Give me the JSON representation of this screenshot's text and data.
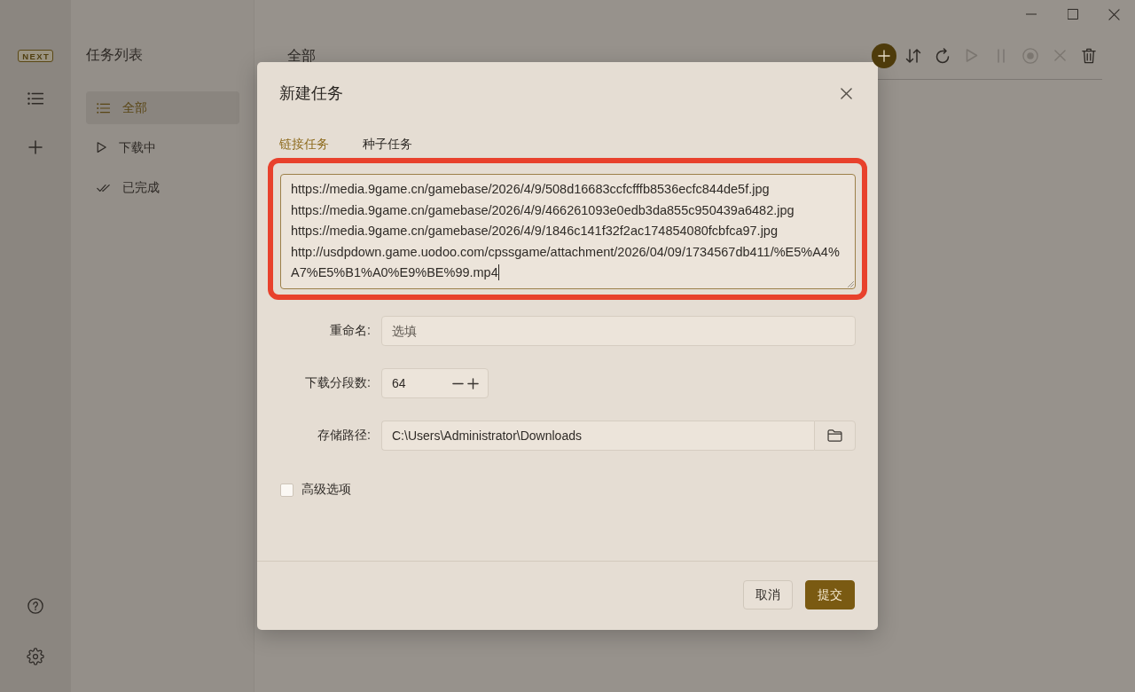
{
  "app_rail": {
    "logo": "NEXT"
  },
  "task_list": {
    "title": "任务列表",
    "items": [
      {
        "label": "全部",
        "kind": "all",
        "selected": true
      },
      {
        "label": "下载中",
        "kind": "downloading",
        "selected": false
      },
      {
        "label": "已完成",
        "kind": "completed",
        "selected": false
      }
    ]
  },
  "main": {
    "title": "全部",
    "toolbar": [
      {
        "kind": "add",
        "disabled": false
      },
      {
        "kind": "sort",
        "disabled": false
      },
      {
        "kind": "refresh",
        "disabled": false
      },
      {
        "kind": "start",
        "disabled": true
      },
      {
        "kind": "pause",
        "disabled": true
      },
      {
        "kind": "stop",
        "disabled": true
      },
      {
        "kind": "cancel",
        "disabled": true
      },
      {
        "kind": "delete",
        "disabled": false
      }
    ]
  },
  "dialog": {
    "title": "新建任务",
    "tabs": [
      {
        "label": "链接任务",
        "selected": true
      },
      {
        "label": "种子任务",
        "selected": false
      }
    ],
    "links": {
      "value": "https://media.9game.cn/gamebase/2026/4/9/508d16683ccfcfffb8536ecfc844de5f.jpg\nhttps://media.9game.cn/gamebase/2026/4/9/466261093e0edb3da855c950439a6482.jpg\nhttps://media.9game.cn/gamebase/2026/4/9/1846c141f32f2ac174854080fcbfca97.jpg\nhttp://usdpdown.game.uodoo.com/cpssgame/attachment/2026/04/09/1734567db411/%E5%A4%A7%E5%B1%A0%E9%BE%99.mp4",
      "focused": true,
      "highlighted": true
    },
    "fields": [
      {
        "kind": "text",
        "label": "重命名:",
        "placeholder": "选填"
      },
      {
        "kind": "number",
        "label": "下载分段数:",
        "value": "64"
      },
      {
        "kind": "path",
        "label": "存储路径:",
        "value": "C:\\Users\\Administrator\\Downloads"
      }
    ],
    "advanced": {
      "label": "高级选项",
      "checked": false
    },
    "buttons": [
      {
        "label": "取消",
        "kind": "secondary"
      },
      {
        "label": "提交",
        "kind": "primary"
      }
    ]
  }
}
